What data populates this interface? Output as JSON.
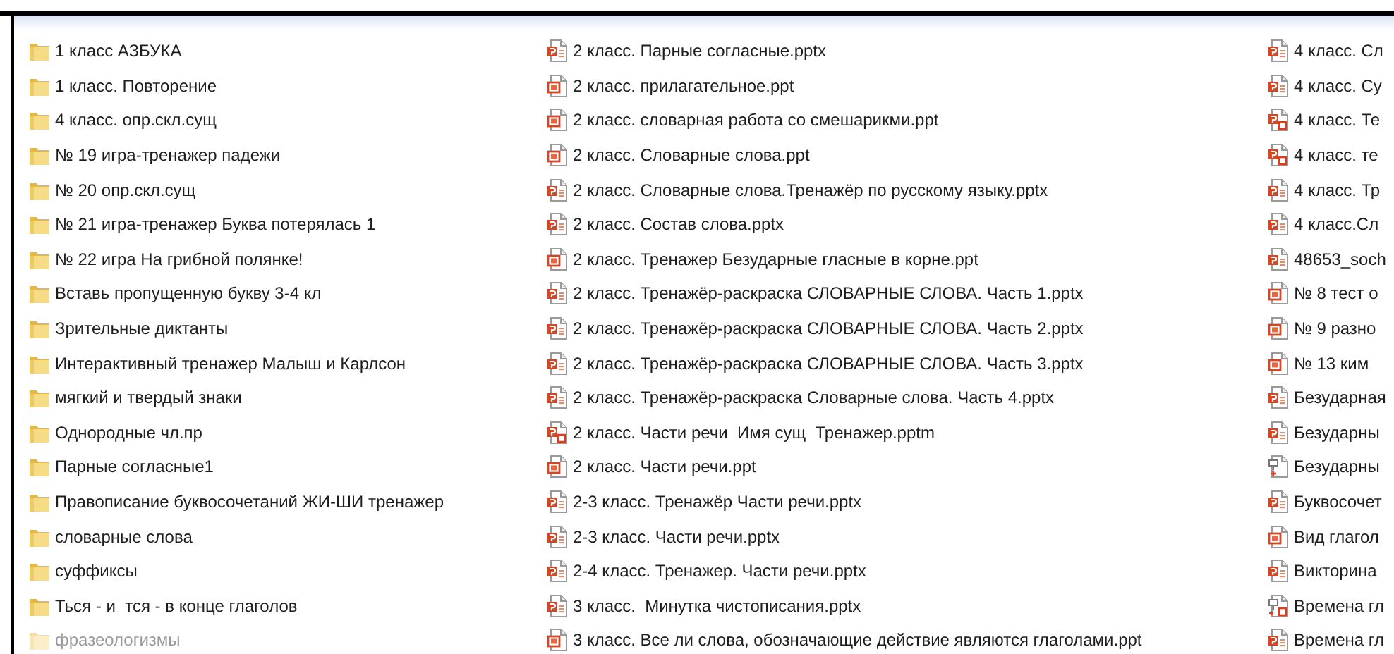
{
  "columns": [
    {
      "items": [
        {
          "kind": "folder",
          "name": "1 класс АЗБУКА",
          "hidden": false
        },
        {
          "kind": "folder",
          "name": "1 класс. Повторение",
          "hidden": false
        },
        {
          "kind": "folder",
          "name": "4 класс. опр.скл.сущ",
          "hidden": false
        },
        {
          "kind": "folder",
          "name": "№ 19 игра-тренажер падежи",
          "hidden": false
        },
        {
          "kind": "folder",
          "name": "№ 20 опр.скл.сущ",
          "hidden": false
        },
        {
          "kind": "folder",
          "name": "№ 21 игра-тренажер Буква потерялась 1",
          "hidden": false
        },
        {
          "kind": "folder",
          "name": "№ 22 игра На грибной полянке!",
          "hidden": false
        },
        {
          "kind": "folder",
          "name": "Вставь пропущенную букву 3-4 кл",
          "hidden": false
        },
        {
          "kind": "folder",
          "name": "Зрительные диктанты",
          "hidden": false
        },
        {
          "kind": "folder",
          "name": "Интерактивный тренажер Малыш и Карлсон",
          "hidden": false
        },
        {
          "kind": "folder",
          "name": "мягкий и твердый знаки",
          "hidden": false
        },
        {
          "kind": "folder",
          "name": "Однородные чл.пр",
          "hidden": false
        },
        {
          "kind": "folder",
          "name": "Парные согласные1",
          "hidden": false
        },
        {
          "kind": "folder",
          "name": "Правописание буквосочетаний ЖИ-ШИ тренажер",
          "hidden": false
        },
        {
          "kind": "folder",
          "name": "словарные слова",
          "hidden": false
        },
        {
          "kind": "folder",
          "name": "суффиксы",
          "hidden": false
        },
        {
          "kind": "folder",
          "name": "Ться - и  тся - в конце глаголов",
          "hidden": false
        },
        {
          "kind": "folder",
          "name": "фразеологизмы",
          "hidden": true
        }
      ]
    },
    {
      "items": [
        {
          "kind": "pptx",
          "name": "2 класс. Парные согласные.pptx",
          "hidden": false
        },
        {
          "kind": "ppt",
          "name": "2 класс. прилагательное.ppt",
          "hidden": false
        },
        {
          "kind": "ppt",
          "name": "2 класс. словарная работа со смешарикми.ppt",
          "hidden": false
        },
        {
          "kind": "ppt",
          "name": "2 класс. Словарные слова.ppt",
          "hidden": false
        },
        {
          "kind": "pptx",
          "name": "2 класс. Словарные слова.Тренажёр по русскому языку.pptx",
          "hidden": false
        },
        {
          "kind": "pptx",
          "name": "2 класс. Состав слова.pptx",
          "hidden": false
        },
        {
          "kind": "ppt",
          "name": "2 класс. Тренажер Безударные гласные в корне.ppt",
          "hidden": false
        },
        {
          "kind": "pptx",
          "name": "2 класс. Тренажёр-раскраска СЛОВАРНЫЕ СЛОВА. Часть 1.pptx",
          "hidden": false
        },
        {
          "kind": "pptx",
          "name": "2 класс. Тренажёр-раскраска СЛОВАРНЫЕ СЛОВА. Часть 2.pptx",
          "hidden": false
        },
        {
          "kind": "pptx",
          "name": "2 класс. Тренажёр-раскраска СЛОВАРНЫЕ СЛОВА. Часть 3.pptx",
          "hidden": false
        },
        {
          "kind": "pptx",
          "name": "2 класс. Тренажёр-раскраска Словарные слова. Часть 4.pptx",
          "hidden": false
        },
        {
          "kind": "pptm",
          "name": "2 класс. Части речи  Имя сущ  Тренажер.pptm",
          "hidden": false
        },
        {
          "kind": "ppt",
          "name": "2 класс. Части речи.ppt",
          "hidden": false
        },
        {
          "kind": "pptx",
          "name": "2-3 класс. Тренажёр Части речи.pptx",
          "hidden": false
        },
        {
          "kind": "pptx",
          "name": "2-3 класс. Части речи.pptx",
          "hidden": false
        },
        {
          "kind": "pptx",
          "name": "2-4 класс. Тренажер. Части речи.pptx",
          "hidden": false
        },
        {
          "kind": "pptx",
          "name": "3 класс.  Минутка чистописания.pptx",
          "hidden": false
        },
        {
          "kind": "ppt",
          "name": "3 класс. Все ли слова, обозначающие действие являются глаголами.ppt",
          "hidden": false
        }
      ]
    },
    {
      "items": [
        {
          "kind": "pptx",
          "name": "4 класс. Сл",
          "hidden": false
        },
        {
          "kind": "pptx",
          "name": "4 класс. Су",
          "hidden": false
        },
        {
          "kind": "pptm",
          "name": "4 класс. Те",
          "hidden": false
        },
        {
          "kind": "pptm",
          "name": "4 класс. те",
          "hidden": false
        },
        {
          "kind": "pptx",
          "name": "4 класс. Тр",
          "hidden": false
        },
        {
          "kind": "pptx",
          "name": "4 класс.Сл",
          "hidden": false
        },
        {
          "kind": "pptx",
          "name": "48653_soch",
          "hidden": false
        },
        {
          "kind": "ppt",
          "name": "№ 8 тест о",
          "hidden": false
        },
        {
          "kind": "ppt",
          "name": "№ 9 разно",
          "hidden": false
        },
        {
          "kind": "ppt",
          "name": "№ 13 ким",
          "hidden": false
        },
        {
          "kind": "pptx",
          "name": "Безударная",
          "hidden": false
        },
        {
          "kind": "pptx",
          "name": "Безударны",
          "hidden": false
        },
        {
          "kind": "template",
          "name": "Безударны",
          "hidden": false
        },
        {
          "kind": "pptx",
          "name": "Буквосочет",
          "hidden": false
        },
        {
          "kind": "ppt",
          "name": "Вид глагол",
          "hidden": false
        },
        {
          "kind": "pptx",
          "name": "Викторина",
          "hidden": false
        },
        {
          "kind": "template-macro",
          "name": "Времена гл",
          "hidden": false
        },
        {
          "kind": "pptx",
          "name": "Времена гл",
          "hidden": false
        }
      ]
    }
  ]
}
